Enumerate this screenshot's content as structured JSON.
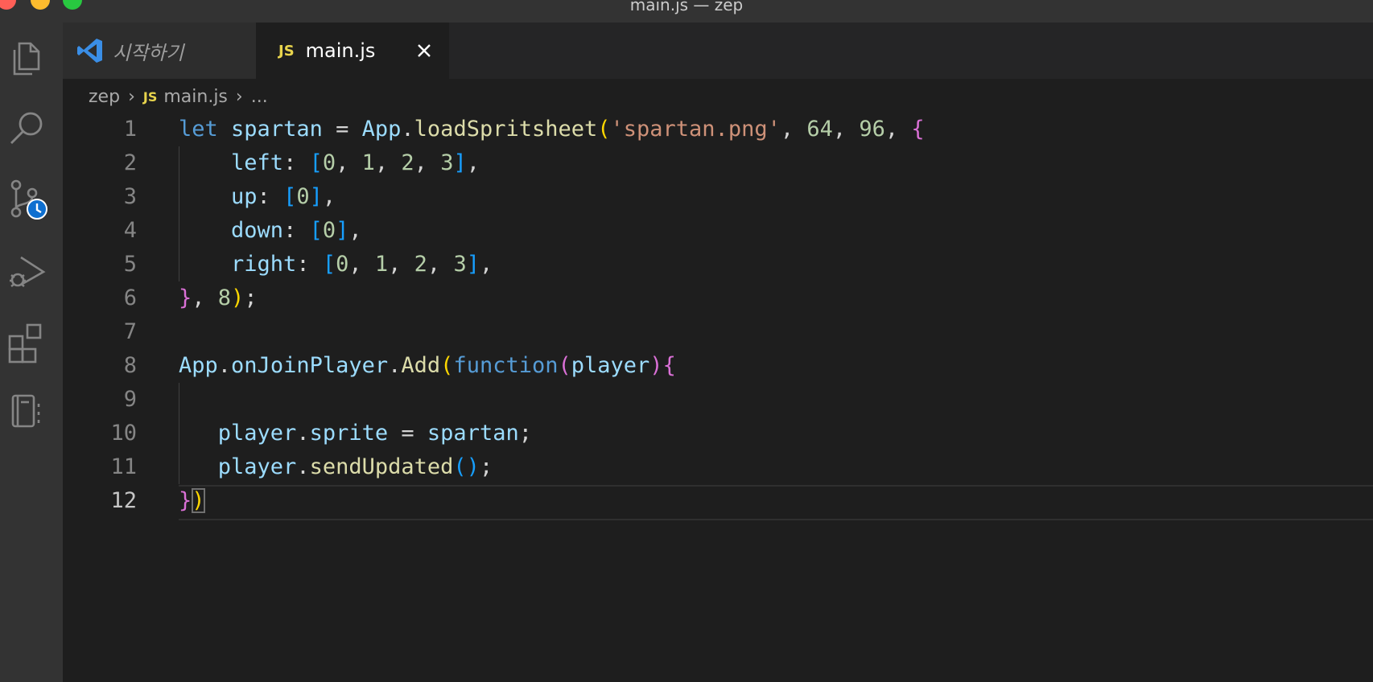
{
  "window": {
    "title": "main.js — zep"
  },
  "activity_bar": {
    "icons": [
      "files-icon",
      "search-icon",
      "source-control-icon",
      "run-debug-icon",
      "extensions-icon",
      "notebook-icon"
    ]
  },
  "tabs": [
    {
      "label": "시작하기",
      "icon": "vscode-logo-icon",
      "active": false
    },
    {
      "label": "main.js",
      "badge": "JS",
      "active": true,
      "close_icon": "close-icon"
    }
  ],
  "breadcrumb": {
    "folder": "zep",
    "file_badge": "JS",
    "file": "main.js",
    "symbol": "..."
  },
  "editor": {
    "language": "javascript",
    "active_line": 12,
    "lines": [
      {
        "n": "1",
        "text": "let spartan = App.loadSpritsheet('spartan.png', 64, 96, {"
      },
      {
        "n": "2",
        "text": "    left: [0, 1, 2, 3],"
      },
      {
        "n": "3",
        "text": "    up: [0],"
      },
      {
        "n": "4",
        "text": "    down: [0],"
      },
      {
        "n": "5",
        "text": "    right: [0, 1, 2, 3],"
      },
      {
        "n": "6",
        "text": "}, 8);"
      },
      {
        "n": "7",
        "text": ""
      },
      {
        "n": "8",
        "text": "App.onJoinPlayer.Add(function(player){"
      },
      {
        "n": "9",
        "text": ""
      },
      {
        "n": "10",
        "text": "   player.sprite = spartan;"
      },
      {
        "n": "11",
        "text": "   player.sendUpdated();"
      },
      {
        "n": "12",
        "text": "})"
      }
    ]
  },
  "colors": {
    "editor_bg": "#1e1e1e",
    "activity_bar_bg": "#333333",
    "keyword": "#569cd6",
    "variable": "#9cdcfe",
    "function": "#dcdcaa",
    "string": "#ce9178",
    "number": "#b5cea8",
    "bracket_1": "#ffd700",
    "bracket_2": "#da70d6",
    "bracket_3": "#179fff"
  }
}
